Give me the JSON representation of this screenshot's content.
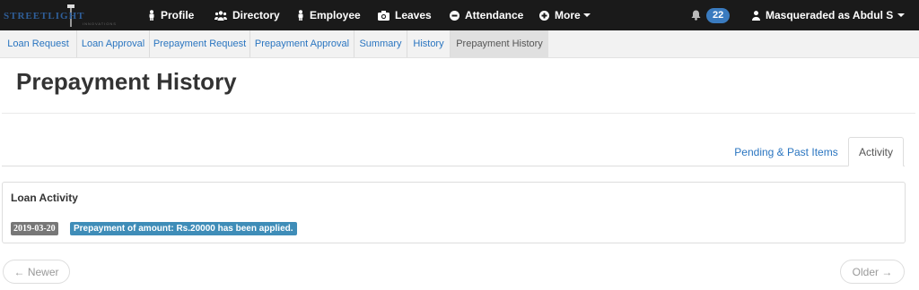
{
  "navbar": {
    "logo_text": "STREETLIGHT",
    "logo_subtext": "INNOVATIONS",
    "items": [
      {
        "label": "Profile",
        "icon": "user-icon"
      },
      {
        "label": "Directory",
        "icon": "users-icon"
      },
      {
        "label": "Employee",
        "icon": "user-icon"
      },
      {
        "label": "Leaves",
        "icon": "camera-icon"
      },
      {
        "label": "Attendance",
        "icon": "minus-circle-icon"
      },
      {
        "label": "More",
        "icon": "plus-circle-icon"
      }
    ],
    "notifications_count": "22",
    "user_label": "Masqueraded as Abdul S"
  },
  "subnav": {
    "items": [
      {
        "label": "Loan Request"
      },
      {
        "label": "Loan Approval"
      },
      {
        "label": "Prepayment Request"
      },
      {
        "label": "Prepayment Approval"
      },
      {
        "label": "Summary"
      },
      {
        "label": "History"
      },
      {
        "label": "Prepayment History",
        "active": true
      }
    ]
  },
  "page": {
    "title": "Prepayment History"
  },
  "tabs": {
    "pending": "Pending & Past Items",
    "activity": "Activity"
  },
  "panel": {
    "title": "Loan Activity",
    "entries": [
      {
        "date": "2019-03-20",
        "message": "Prepayment of amount: Rs.20000 has been applied."
      }
    ]
  },
  "pager": {
    "newer": "← Newer",
    "older": "Older →"
  },
  "colors": {
    "navbar_bg": "#1a1a1a",
    "link": "#2a75c0",
    "badge": "#3a7bbf",
    "message_label": "#3f8db8",
    "date_label": "#777777"
  }
}
